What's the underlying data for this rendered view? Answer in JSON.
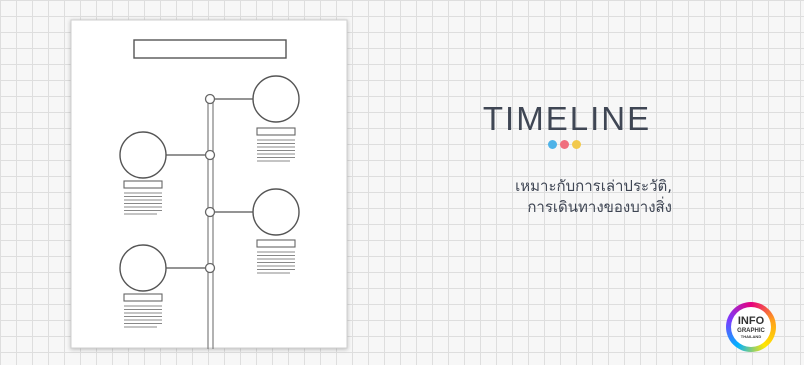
{
  "heading": {
    "title": "TIMELINE",
    "dots": [
      "#4fb3e8",
      "#f06f7e",
      "#f2c94c"
    ]
  },
  "description": {
    "line1": "เหมาะกับการเล่าประวัติ,",
    "line2": "การเดินทางของบางสิ่ง"
  },
  "logo": {
    "line1": "INFO",
    "line2": "GRAPHIC",
    "line3": "THAILAND"
  }
}
